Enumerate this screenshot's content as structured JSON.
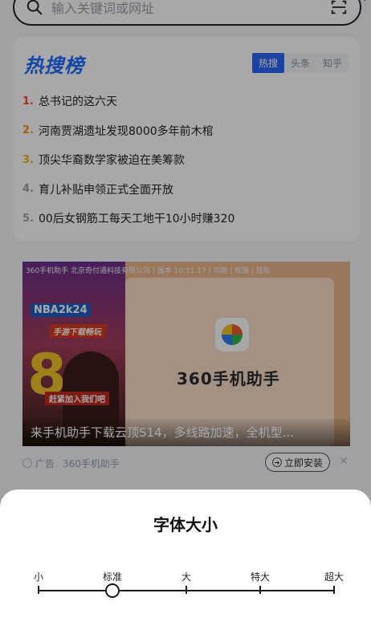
{
  "search": {
    "placeholder": "输入关键词或网址"
  },
  "hot": {
    "title": "热搜榜",
    "tabs": [
      {
        "label": "热搜",
        "active": true
      },
      {
        "label": "头条",
        "active": false
      },
      {
        "label": "知乎",
        "active": false
      }
    ],
    "items": [
      {
        "rank": "1.",
        "text": "总书记的这六天"
      },
      {
        "rank": "2.",
        "text": "河南贾湖遗址发现8000多年前木棺"
      },
      {
        "rank": "3.",
        "text": "顶尖华裔数学家被迫在美筹款"
      },
      {
        "rank": "4.",
        "text": "育儿补贴申领正式全面开放"
      },
      {
        "rank": "5.",
        "text": "00后女钢筋工每天工地干10小时赚320"
      }
    ]
  },
  "ad": {
    "meta": "360手机助手 北京奇付通科技有限公司 | 版本 10.11.17 | 功能 | 权限 | 隐私",
    "nba_logo": "NBA2k24",
    "tag_top": "手游下载畅玩",
    "tag_bottom": "赶紧加入我们吧",
    "big_number": "8",
    "app_name": "360手机助手",
    "caption": "来手机助手下载云顶S14，多线路加速，全机型...",
    "label": "广告",
    "source": "360手机助手",
    "install": "立即安装",
    "close": "✕"
  },
  "sheet": {
    "title": "字体大小",
    "sizes": [
      "小",
      "标准",
      "大",
      "特大",
      "超大"
    ],
    "selected_index": 1
  },
  "colors": {
    "accent": "#1e6bff",
    "rank1": "#f04a2f",
    "rank2": "#ff8a00",
    "rank3": "#f6b400"
  }
}
